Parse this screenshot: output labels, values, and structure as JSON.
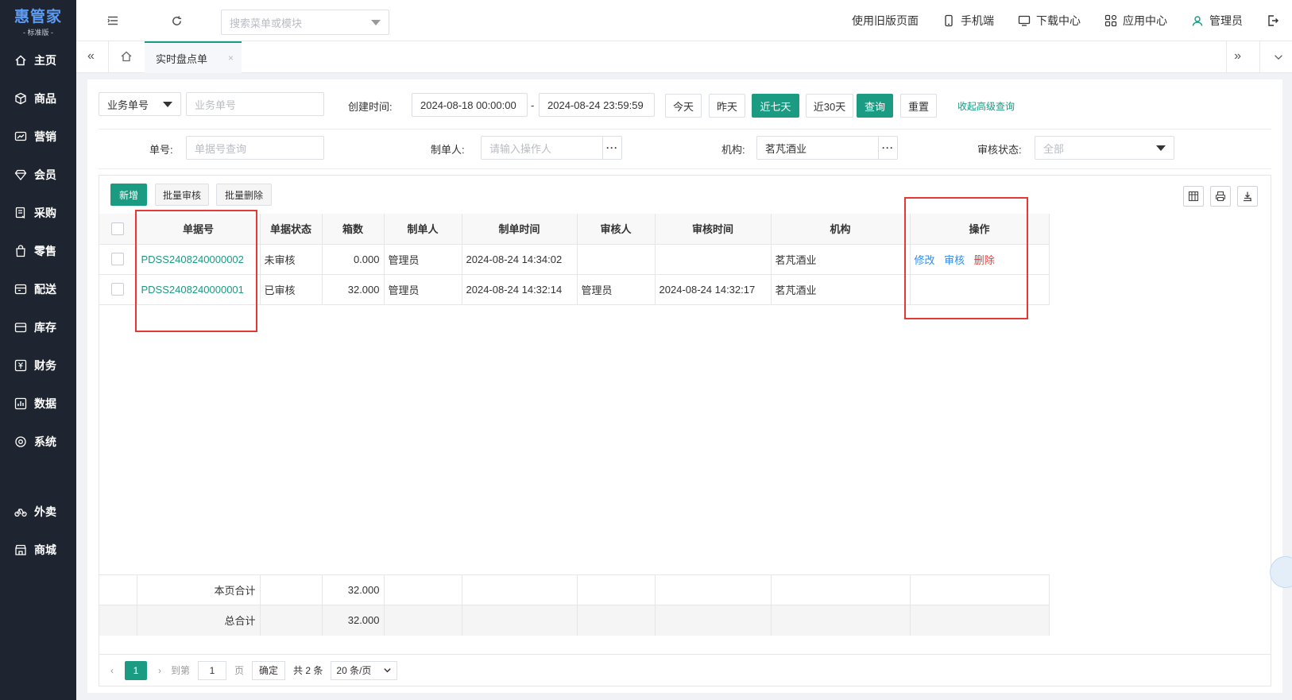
{
  "brand": {
    "name": "惠管家",
    "edition": "- 标准版 -"
  },
  "sidebar": {
    "items": [
      {
        "label": "主页",
        "icon": "home-icon"
      },
      {
        "label": "商品",
        "icon": "box-icon"
      },
      {
        "label": "营销",
        "icon": "chart-card-icon"
      },
      {
        "label": "会员",
        "icon": "diamond-icon"
      },
      {
        "label": "采购",
        "icon": "purchase-icon"
      },
      {
        "label": "零售",
        "icon": "bag-icon"
      },
      {
        "label": "配送",
        "icon": "delivery-icon"
      },
      {
        "label": "库存",
        "icon": "inventory-icon"
      },
      {
        "label": "财务",
        "icon": "yuan-icon"
      },
      {
        "label": "数据",
        "icon": "data-icon"
      },
      {
        "label": "系统",
        "icon": "settings-icon"
      }
    ],
    "extra_items": [
      {
        "label": "外卖",
        "icon": "bike-icon"
      },
      {
        "label": "商城",
        "icon": "store-icon"
      }
    ]
  },
  "topbar": {
    "search_placeholder": "搜索菜单或模块",
    "legacy": "使用旧版页面",
    "mobile": "手机端",
    "download": "下载中心",
    "apps": "应用中心",
    "user": "管理员"
  },
  "tabs": {
    "active": "实时盘点单",
    "close": "×"
  },
  "filters": {
    "type_select": "业务单号",
    "type_placeholder": "业务单号",
    "created_label": "创建时间:",
    "start": "2024-08-18 00:00:00",
    "dash": "-",
    "end": "2024-08-24 23:59:59",
    "btn_today": "今天",
    "btn_yesterday": "昨天",
    "btn_7days": "近七天",
    "btn_30days": "近30天",
    "btn_query": "查询",
    "btn_reset": "重置",
    "collapse": "收起高级查询",
    "bill_label": "单号:",
    "bill_placeholder": "单据号查询",
    "maker_label": "制单人:",
    "maker_placeholder": "请输入操作人",
    "org_label": "机构:",
    "org_value": "茗芃酒业",
    "audit_label": "审核状态:",
    "audit_value": "全部",
    "dots": "···"
  },
  "toolbar": {
    "add": "新增",
    "batch_audit": "批量审核",
    "batch_delete": "批量删除"
  },
  "table": {
    "headers": [
      "单据号",
      "单据状态",
      "箱数",
      "制单人",
      "制单时间",
      "审核人",
      "审核时间",
      "机构",
      "操作"
    ],
    "rows": [
      {
        "bill": "PDSS2408240000002",
        "status": "未审核",
        "boxes": "0.000",
        "maker": "管理员",
        "time": "2024-08-24 14:34:02",
        "auditor": "",
        "audit_time": "",
        "org": "茗芃酒业",
        "actions": {
          "edit": "修改",
          "audit": "审核",
          "delete": "删除"
        }
      },
      {
        "bill": "PDSS2408240000001",
        "status": "已审核",
        "boxes": "32.000",
        "maker": "管理员",
        "time": "2024-08-24 14:32:14",
        "auditor": "管理员",
        "audit_time": "2024-08-24 14:32:17",
        "org": "茗芃酒业",
        "actions": null
      }
    ],
    "page_total_label": "本页合计",
    "page_total": "32.000",
    "grand_total_label": "总合计",
    "grand_total": "32.000"
  },
  "pager": {
    "current": "1",
    "goto": "到第",
    "page_input": "1",
    "page_unit": "页",
    "confirm": "确定",
    "total": "共 2 条",
    "per_page": "20 条/页"
  },
  "colors": {
    "accent": "#1a9b82",
    "sidebar": "#1f2530",
    "link_blue": "#2d8cf0",
    "danger": "#e63b3b",
    "highlight_box": "#e53935"
  }
}
